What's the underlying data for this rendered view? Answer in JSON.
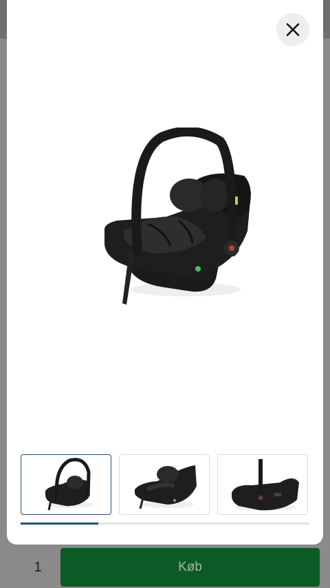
{
  "modal": {
    "close_icon": "close-icon",
    "main_image": "infant-car-seat-front-three-quarter",
    "thumbnails": [
      {
        "image": "infant-car-seat-handle-up",
        "selected": true
      },
      {
        "image": "infant-car-seat-side-angle",
        "selected": false
      },
      {
        "image": "infant-car-seat-profile",
        "selected": false
      }
    ],
    "gallery_progress_fraction": 0.27
  },
  "purchase": {
    "quantity": "1",
    "buy_label": "Køb"
  },
  "colors": {
    "accent": "#1f4f7a",
    "buy_button": "#0c5a26"
  }
}
